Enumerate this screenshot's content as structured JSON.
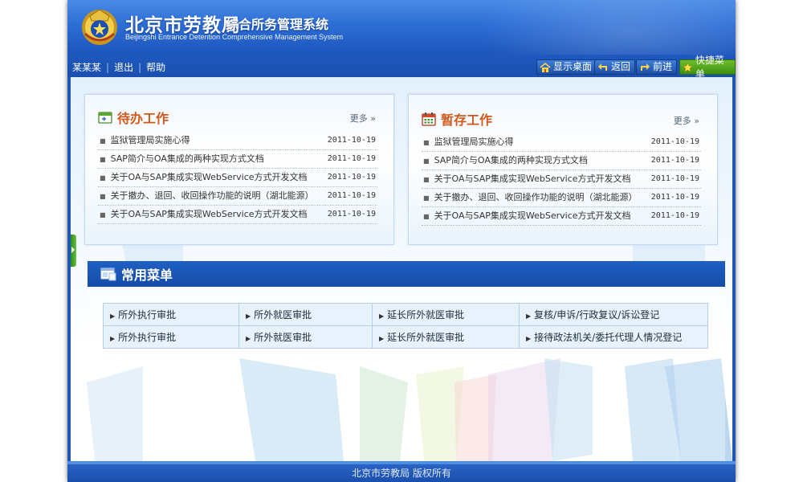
{
  "header": {
    "title": "北京市劳教局",
    "subtitle": "综合所务管理系统",
    "english_title": "Beijingshi Entrance Detention Comprehensive Management System",
    "emblem_icon": "police-emblem-icon"
  },
  "toolbar": {
    "user_links": [
      "某某某",
      "退出",
      "帮助"
    ],
    "buttons": [
      {
        "label": "显示桌面",
        "icon": "home-icon"
      },
      {
        "label": "返回",
        "icon": "back-arrow-icon"
      },
      {
        "label": "前进",
        "icon": "forward-arrow-icon"
      },
      {
        "label": "快捷菜单",
        "icon": "star-icon"
      }
    ]
  },
  "pending": {
    "title": "待办工作",
    "icon": "inbox-icon",
    "more": "更多",
    "items": [
      {
        "title": "监狱管理局实施心得",
        "date": "2011-10-19"
      },
      {
        "title": "SAP简介与OA集成的两种实现方式文档",
        "date": "2011-10-19"
      },
      {
        "title": "关于OA与SAP集成实现WebService方式开发文档",
        "date": "2011-10-19"
      },
      {
        "title": "关于撤办、退回、收回操作功能的说明（湖北能源）",
        "date": "2011-10-19"
      },
      {
        "title": "关于OA与SAP集成实现WebService方式开发文档",
        "date": "2011-10-19"
      }
    ]
  },
  "draft": {
    "title": "暂存工作",
    "icon": "calendar-icon",
    "more": "更多",
    "items": [
      {
        "title": "监狱管理局实施心得",
        "date": "2011-10-19"
      },
      {
        "title": "SAP简介与OA集成的两种实现方式文档",
        "date": "2011-10-19"
      },
      {
        "title": "关于OA与SAP集成实现WebService方式开发文档",
        "date": "2011-10-19"
      },
      {
        "title": "关于撤办、退回、收回操作功能的说明（湖北能源）",
        "date": "2011-10-19"
      },
      {
        "title": "关于OA与SAP集成实现WebService方式开发文档",
        "date": "2011-10-19"
      }
    ]
  },
  "common_menu": {
    "title": "常用菜单",
    "icon": "window-icon",
    "rows": [
      [
        "所外执行审批",
        "所外就医审批",
        "延长所外就医审批",
        "复核/申诉/行政复议/诉讼登记"
      ],
      [
        "所外执行审批",
        "所外就医审批",
        "延长所外就医审批",
        "接待政法机关/委托代理人情况登记"
      ]
    ]
  },
  "footer": {
    "text": "北京市劳教局  版权所有"
  },
  "colors": {
    "brand_blue": "#1e56b4",
    "panel_title_orange": "#d2571a",
    "shortcut_green": "#4aa01a"
  }
}
